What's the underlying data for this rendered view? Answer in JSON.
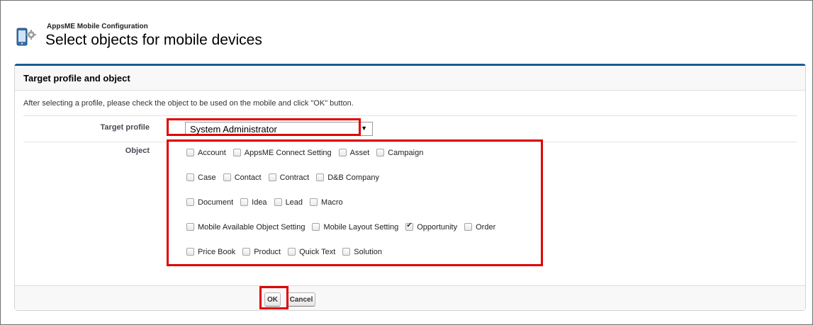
{
  "header": {
    "subtitle": "AppsME Mobile Configuration",
    "title": "Select objects for mobile devices",
    "icon": "mobile-device-icon"
  },
  "panel": {
    "title": "Target profile and object",
    "instruction": "After selecting a profile, please check the object to be used on the mobile and click \"OK\" button.",
    "profile_label": "Target profile",
    "profile_value": "System Administrator",
    "object_label": "Object",
    "objects": [
      [
        {
          "label": "Account",
          "checked": false
        },
        {
          "label": "AppsME Connect Setting",
          "checked": false
        },
        {
          "label": "Asset",
          "checked": false
        },
        {
          "label": "Campaign",
          "checked": false
        }
      ],
      [
        {
          "label": "Case",
          "checked": false
        },
        {
          "label": "Contact",
          "checked": false
        },
        {
          "label": "Contract",
          "checked": false
        },
        {
          "label": "D&B Company",
          "checked": false
        }
      ],
      [
        {
          "label": "Document",
          "checked": false
        },
        {
          "label": "Idea",
          "checked": false
        },
        {
          "label": "Lead",
          "checked": false
        },
        {
          "label": "Macro",
          "checked": false
        }
      ],
      [
        {
          "label": "Mobile Available Object Setting",
          "checked": false
        },
        {
          "label": "Mobile Layout Setting",
          "checked": false
        },
        {
          "label": "Opportunity",
          "checked": true
        },
        {
          "label": "Order",
          "checked": false
        }
      ],
      [
        {
          "label": "Price Book",
          "checked": false
        },
        {
          "label": "Product",
          "checked": false
        },
        {
          "label": "Quick Text",
          "checked": false
        },
        {
          "label": "Solution",
          "checked": false
        }
      ]
    ]
  },
  "footer": {
    "ok_label": "OK",
    "cancel_label": "Cancel"
  },
  "colors": {
    "highlight": "#e00000",
    "panel_accent": "#1a5a96"
  }
}
